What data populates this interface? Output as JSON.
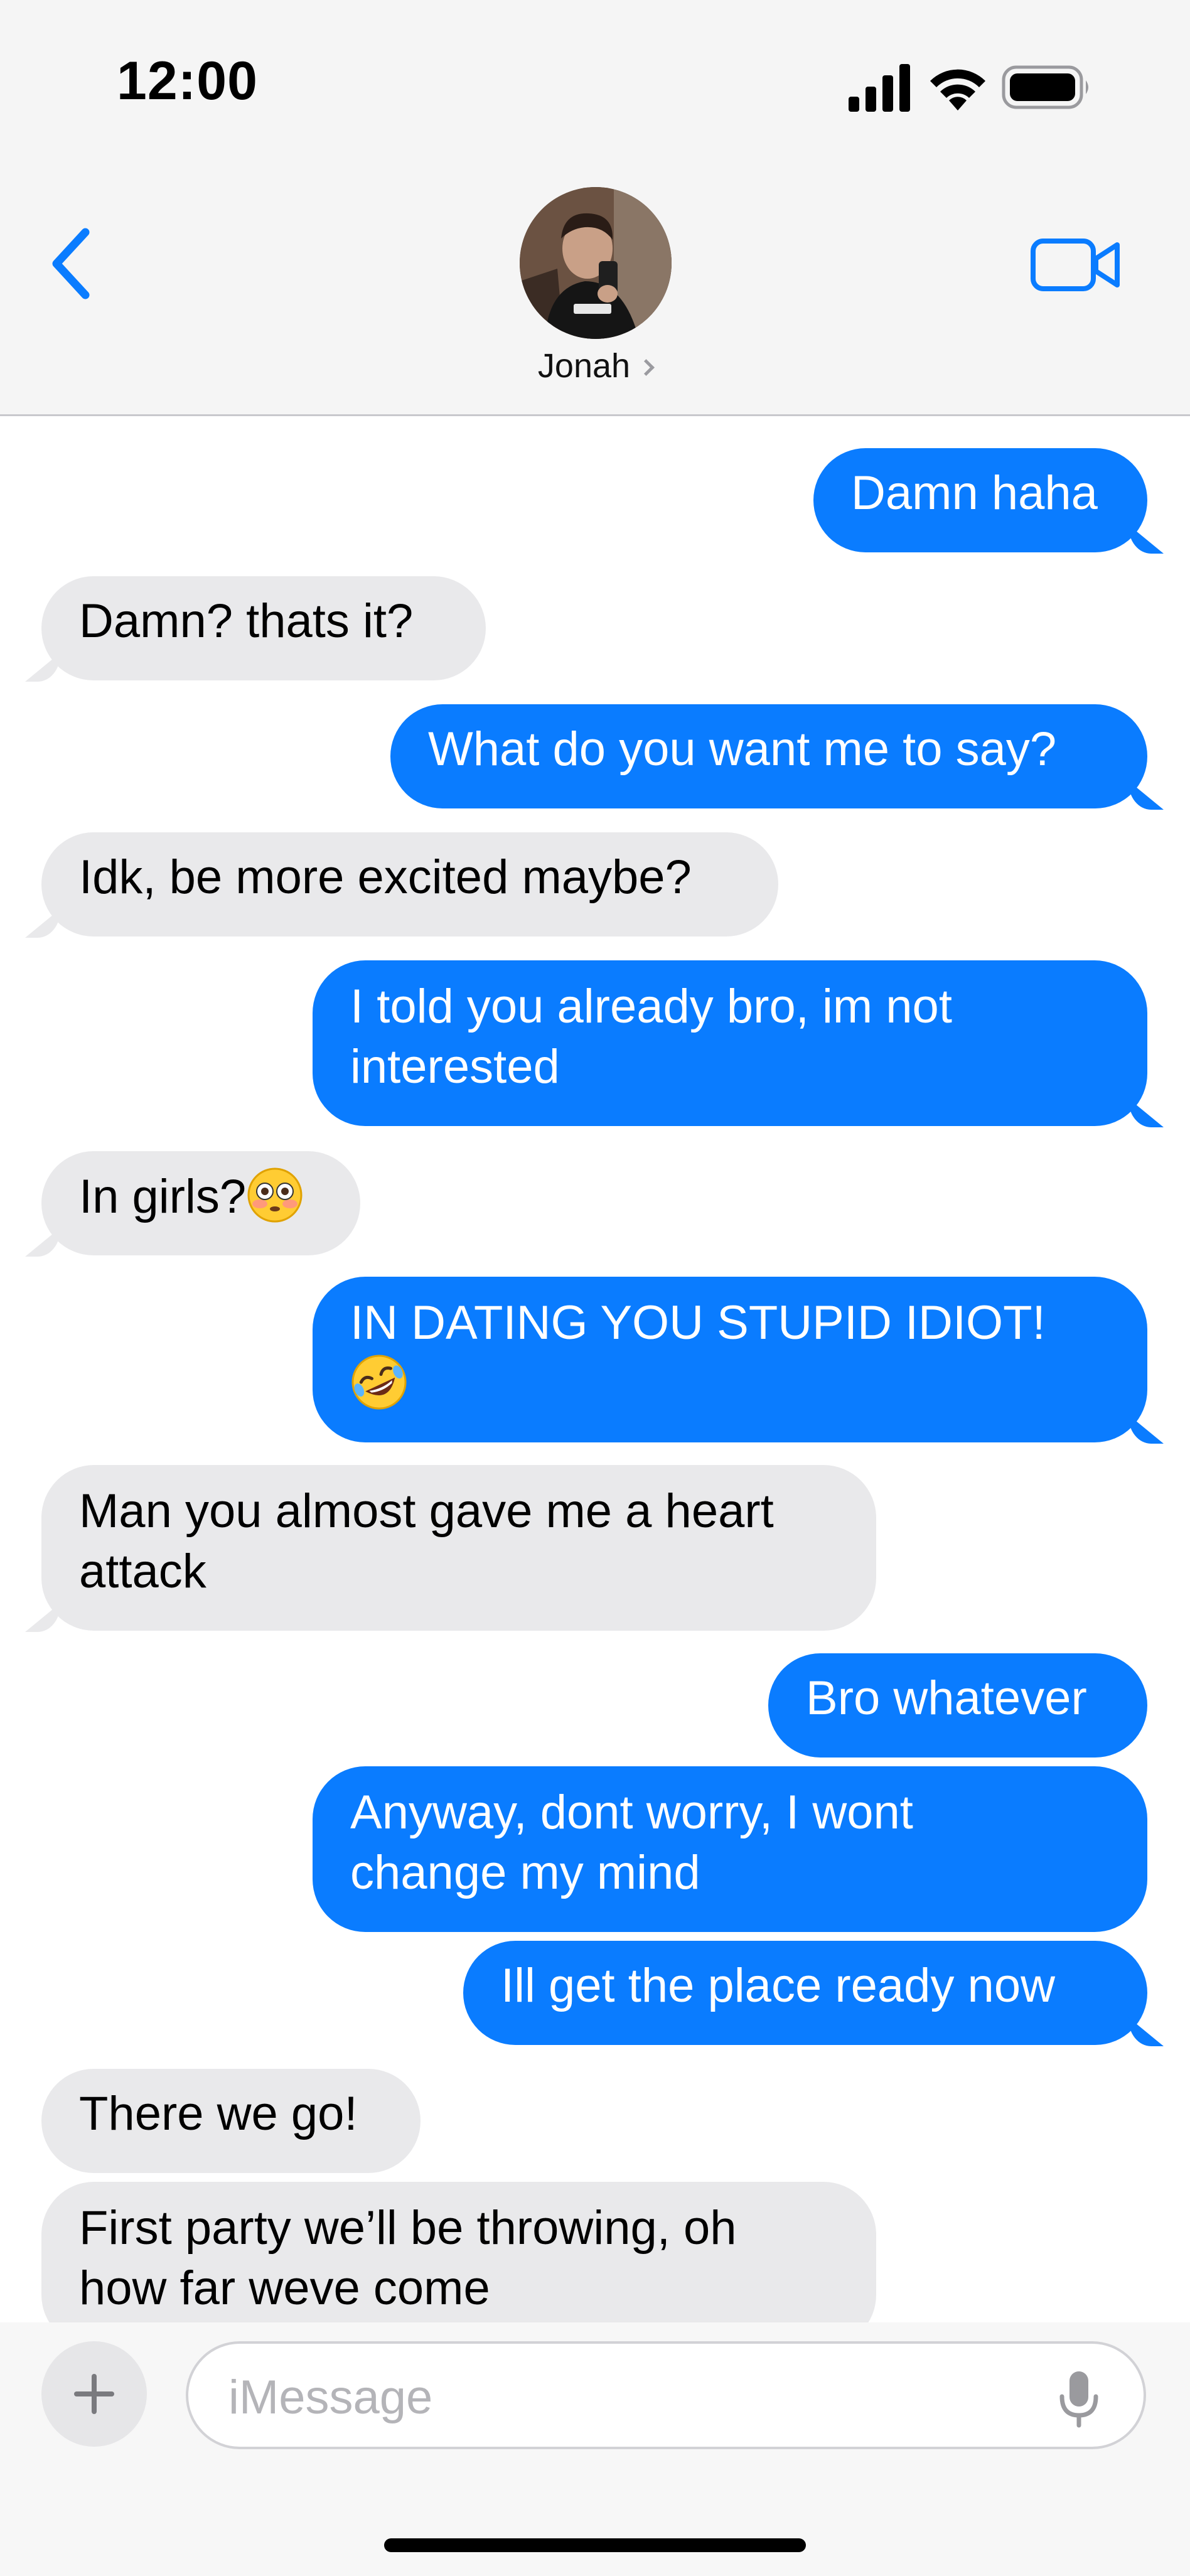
{
  "status_bar": {
    "time": "12:00",
    "signal_icon": "cellular-signal-icon",
    "wifi_icon": "wifi-icon",
    "battery_icon": "battery-icon"
  },
  "header": {
    "contact_name": "Jonah",
    "back_icon": "chevron-left-icon",
    "video_icon": "facetime-video-icon",
    "contact_chevron_icon": "chevron-right-icon"
  },
  "messages": [
    {
      "direction": "outgoing",
      "text": "Damn haha"
    },
    {
      "direction": "incoming",
      "text": "Damn? thats it?"
    },
    {
      "direction": "outgoing",
      "text": "What do you want me to say?"
    },
    {
      "direction": "incoming",
      "text": "Idk, be more excited maybe?"
    },
    {
      "direction": "outgoing",
      "line1": "I told you already bro, im not",
      "line2": "interested"
    },
    {
      "direction": "incoming",
      "text": "In girls?",
      "emoji": "flushed-face-emoji"
    },
    {
      "direction": "outgoing",
      "line1": "IN DATING YOU STUPID IDIOT!",
      "emoji": "rolling-on-floor-laughing-emoji"
    },
    {
      "direction": "incoming",
      "line1": "Man you almost gave me a heart",
      "line2": "attack"
    },
    {
      "direction": "outgoing",
      "text": "Bro whatever"
    },
    {
      "direction": "outgoing",
      "line1": "Anyway, dont worry, I wont",
      "line2": "change my mind"
    },
    {
      "direction": "outgoing",
      "text": "Ill get the place ready now"
    },
    {
      "direction": "incoming",
      "text": "There we go!"
    },
    {
      "direction": "incoming",
      "line1": "First party we’ll be throwing, oh",
      "line2": "how far weve come"
    }
  ],
  "composer": {
    "placeholder": "iMessage",
    "plus_icon": "plus-icon",
    "mic_icon": "microphone-icon"
  },
  "colors": {
    "outgoing_bubble": "#0a7cff",
    "incoming_bubble": "#e9e9eb",
    "accent": "#0a7cff"
  }
}
